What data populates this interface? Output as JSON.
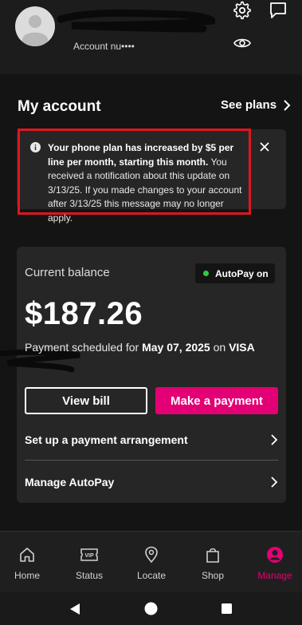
{
  "header": {
    "account_label": "Account nu••••",
    "icons": [
      "gear-icon",
      "chat-icon",
      "eye-icon"
    ]
  },
  "page": {
    "title": "My account",
    "see_plans": "See plans"
  },
  "notice": {
    "bold_text": "Your phone plan has increased by $5 per line per month, starting this month.",
    "body_text": " You received a notification about this update on 3/13/25. If you made changes to your account after 3/13/25 this message may no longer apply."
  },
  "balance": {
    "label": "Current balance",
    "autopay_status": "AutoPay on",
    "amount": "$187.26",
    "scheduled_prefix": "Payment scheduled for ",
    "scheduled_date": "May 07, 2025",
    "scheduled_mid": " on ",
    "scheduled_card": "VISA",
    "view_bill": "View bill",
    "make_payment": "Make a payment",
    "arrangement": "Set up a payment arrangement",
    "manage_autopay": "Manage AutoPay"
  },
  "tabs": [
    {
      "label": "Home",
      "icon": "home-icon"
    },
    {
      "label": "Status",
      "icon": "vip-ticket-icon"
    },
    {
      "label": "Locate",
      "icon": "location-pin-icon"
    },
    {
      "label": "Shop",
      "icon": "shopping-bag-icon"
    },
    {
      "label": "Manage",
      "icon": "user-circle-icon",
      "active": true
    }
  ],
  "colors": {
    "accent": "#e20074",
    "alert_outline": "#e0151f",
    "autopay_dot": "#2ecc40"
  }
}
